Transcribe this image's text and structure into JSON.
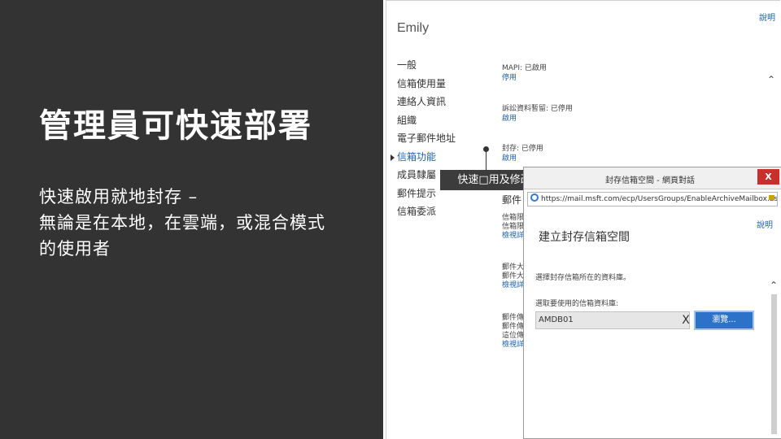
{
  "slide": {
    "title": "管理員可快速部署",
    "body_line1": "快速啟用就地封存 –",
    "body_line2": "無論是在本地，在雲端，或混合模式",
    "body_line3": "的使用者"
  },
  "ecp": {
    "help": "說明",
    "user_name": "Emily",
    "nav": [
      {
        "label": "一般"
      },
      {
        "label": "信箱使用量"
      },
      {
        "label": "連絡人資訊"
      },
      {
        "label": "組織"
      },
      {
        "label": "電子郵件地址"
      },
      {
        "label": "信箱功能"
      },
      {
        "label": "成員隸屬"
      },
      {
        "label": "郵件提示"
      },
      {
        "label": "信箱委派"
      }
    ],
    "sections": [
      {
        "status": "MAPI: 已啟用",
        "link": "停用"
      },
      {
        "status": "訴訟資料暫留: 已停用",
        "link": "啟用"
      },
      {
        "status": "封存: 已停用",
        "link": "啟用"
      }
    ],
    "partial_heading": "郵件",
    "lower_sections": [
      {
        "lines": [
          "信箱限",
          "信箱限"
        ],
        "link": "檢視詳細"
      },
      {
        "lines": [
          "郵件大",
          "郵件大"
        ],
        "link": "檢視詳細"
      },
      {
        "lines": [
          "郵件傳",
          "郵件傳",
          "這位傳"
        ],
        "link": "檢視詳細"
      }
    ]
  },
  "callout": {
    "label": "快速□用及修改"
  },
  "dialog": {
    "title": "封存信箱空間 - 網頁對話",
    "close": "X",
    "address": "https://mail.msft.com/ecp/UsersGroups/EnableArchiveMailbox.aspx?dt",
    "help": "說明",
    "heading": "建立封存信箱空間",
    "description": "選擇封存信箱所在的資料庫。",
    "db_label": "選取要使用的信箱資料庫:",
    "db_value": "AMDB01",
    "clear": "X",
    "browse": "瀏覽..."
  }
}
